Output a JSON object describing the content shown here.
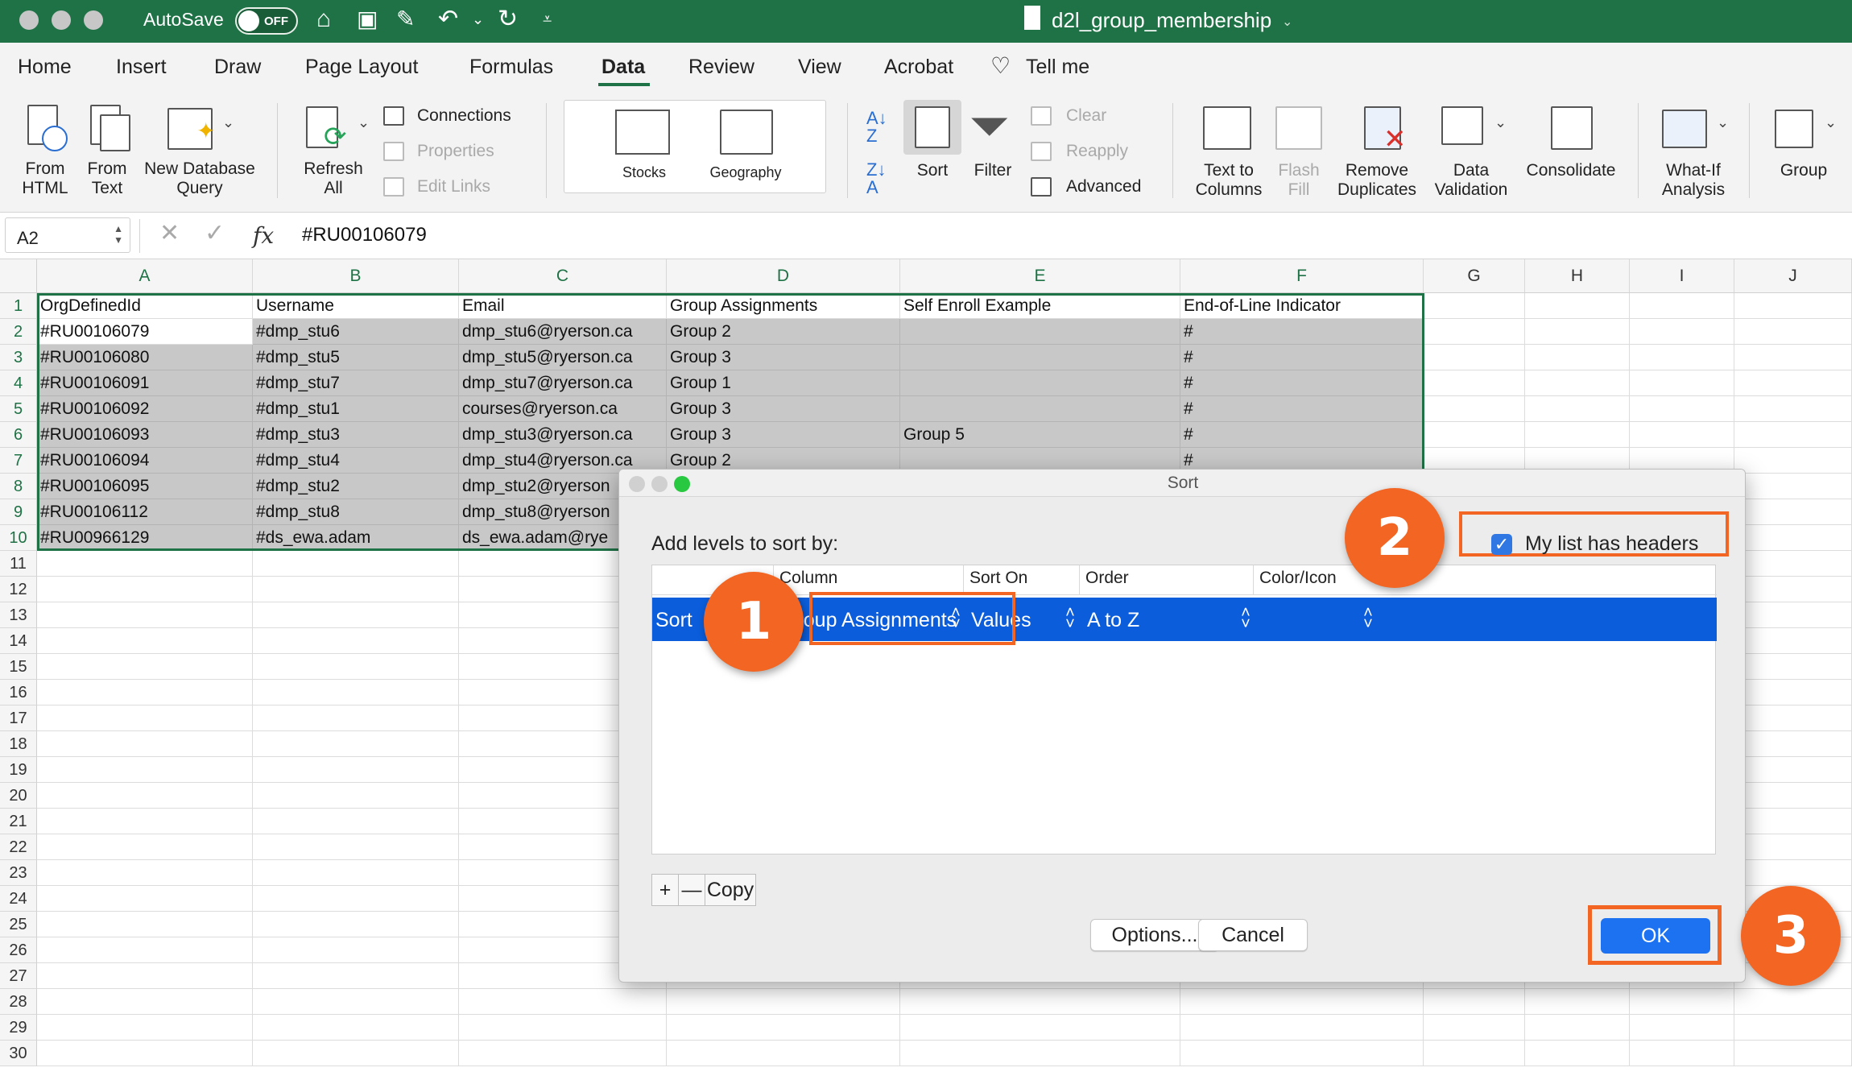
{
  "titlebar": {
    "autosave_label": "AutoSave",
    "autosave_state": "OFF",
    "document_title": "d2l_group_membership"
  },
  "menu": {
    "tabs": [
      "Home",
      "Insert",
      "Draw",
      "Page Layout",
      "Formulas",
      "Data",
      "Review",
      "View",
      "Acrobat",
      "Tell me"
    ],
    "active": "Data"
  },
  "ribbon": {
    "from_html": "From\nHTML",
    "from_text": "From\nText",
    "new_db_query": "New Database\nQuery",
    "refresh_all": "Refresh\nAll",
    "connections": "Connections",
    "properties": "Properties",
    "edit_links": "Edit Links",
    "stocks": "Stocks",
    "geography": "Geography",
    "sort": "Sort",
    "filter": "Filter",
    "clear": "Clear",
    "reapply": "Reapply",
    "advanced": "Advanced",
    "text_to_columns": "Text to\nColumns",
    "flash_fill": "Flash\nFill",
    "remove_duplicates": "Remove\nDuplicates",
    "data_validation": "Data\nValidation",
    "consolidate": "Consolidate",
    "what_if": "What-If\nAnalysis",
    "group": "Group"
  },
  "formula_bar": {
    "name_box": "A2",
    "fx": "fx",
    "value": "#RU00106079"
  },
  "sheet": {
    "columns": [
      "A",
      "B",
      "C",
      "D",
      "E",
      "F",
      "G",
      "H",
      "I",
      "J"
    ],
    "row_numbers": [
      "1",
      "2",
      "3",
      "4",
      "5",
      "6",
      "7",
      "8",
      "9",
      "10",
      "11",
      "12",
      "13",
      "14",
      "15",
      "16",
      "17",
      "18",
      "19",
      "20",
      "21",
      "22",
      "23",
      "24",
      "25",
      "26",
      "27",
      "28",
      "29",
      "30"
    ],
    "header": [
      "OrgDefinedId",
      "Username",
      "Email",
      "Group Assignments",
      "Self Enroll Example",
      "End-of-Line Indicator"
    ],
    "rows": [
      [
        "#RU00106079",
        "#dmp_stu6",
        "dmp_stu6@ryerson.ca",
        "Group 2",
        "",
        "#"
      ],
      [
        "#RU00106080",
        "#dmp_stu5",
        "dmp_stu5@ryerson.ca",
        "Group 3",
        "",
        "#"
      ],
      [
        "#RU00106091",
        "#dmp_stu7",
        "dmp_stu7@ryerson.ca",
        "Group 1",
        "",
        "#"
      ],
      [
        "#RU00106092",
        "#dmp_stu1",
        "courses@ryerson.ca",
        "Group 3",
        "",
        "#"
      ],
      [
        "#RU00106093",
        "#dmp_stu3",
        "dmp_stu3@ryerson.ca",
        "Group 3",
        "Group 5",
        "#"
      ],
      [
        "#RU00106094",
        "#dmp_stu4",
        "dmp_stu4@ryerson.ca",
        "Group 2",
        "",
        "#"
      ],
      [
        "#RU00106095",
        "#dmp_stu2",
        "dmp_stu2@ryerson",
        "",
        "",
        ""
      ],
      [
        "#RU00106112",
        "#dmp_stu8",
        "dmp_stu8@ryerson",
        "",
        "",
        ""
      ],
      [
        "#RU00966129",
        "#ds_ewa.adam",
        "ds_ewa.adam@rye",
        "",
        "",
        ""
      ]
    ]
  },
  "dialog": {
    "title": "Sort",
    "add_levels_label": "Add levels to sort by:",
    "has_headers_label": "My list has headers",
    "has_headers_checked": true,
    "table_headers": [
      "Column",
      "Sort On",
      "Order",
      "Color/Icon"
    ],
    "level": {
      "label": "Sort",
      "column": "Group Assignments",
      "sort_on": "Values",
      "order": "A to Z",
      "color_icon": ""
    },
    "add_button": "+",
    "remove_button": "—",
    "copy_button": "Copy",
    "options_button": "Options...",
    "cancel_button": "Cancel",
    "ok_button": "OK"
  },
  "badges": [
    "1",
    "2",
    "3"
  ],
  "colors": {
    "excel_green": "#1f7246",
    "highlight_orange": "#f26522",
    "selection_blue": "#0b5ddb",
    "ok_blue": "#1c72f0"
  }
}
